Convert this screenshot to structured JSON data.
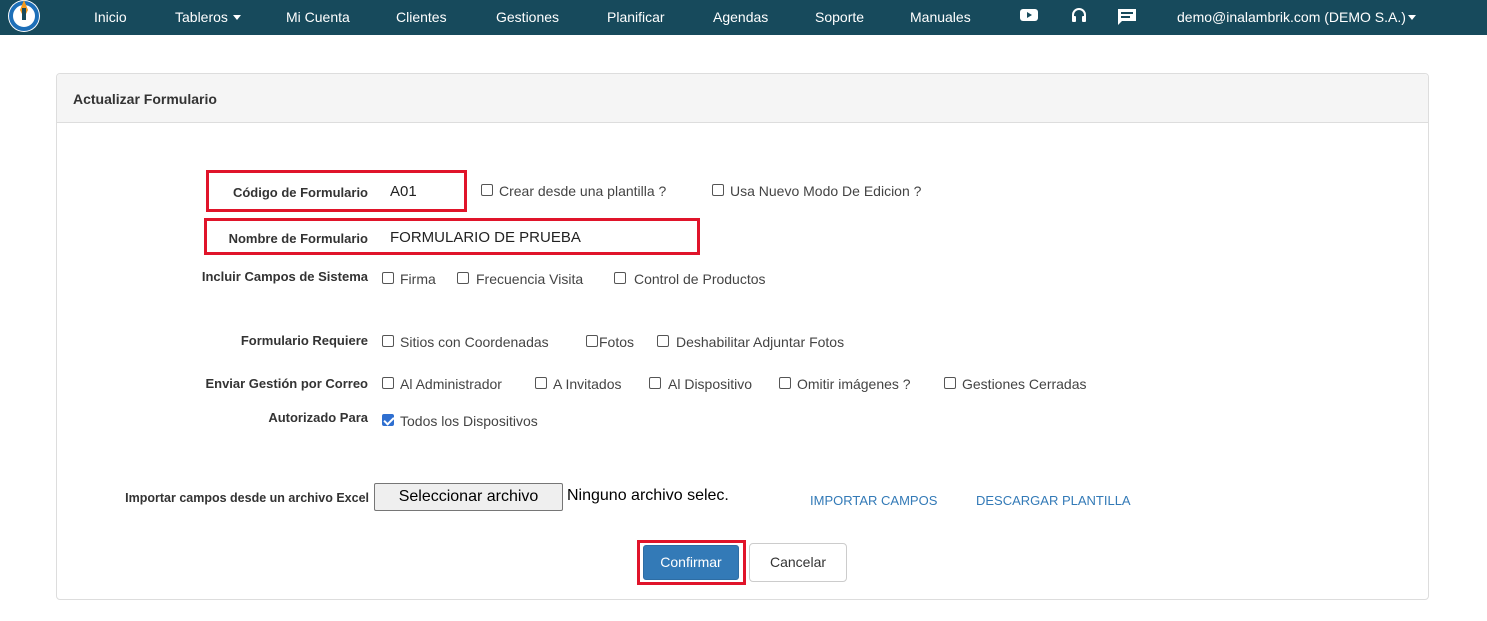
{
  "navbar": {
    "items": [
      "Inicio",
      "Tableros",
      "Mi Cuenta",
      "Clientes",
      "Gestiones",
      "Planificar",
      "Agendas",
      "Soporte",
      "Manuales"
    ],
    "icons": [
      "youtube-icon",
      "headset-icon",
      "chat-icon"
    ],
    "user": "demo@inalambrik.com (DEMO S.A.)",
    "color": "#174a5c"
  },
  "panel": {
    "title": "Actualizar Formulario"
  },
  "form": {
    "codigo_label": "Código de Formulario",
    "codigo_value": "A01",
    "crear_plantilla": "Crear desde una plantilla ?",
    "nuevo_modo": "Usa Nuevo Modo De Edicion ?",
    "nombre_label": "Nombre de Formulario",
    "nombre_value": "FORMULARIO DE PRUEBA",
    "campos_label": "Incluir Campos de Sistema",
    "campos_options": [
      "Firma",
      "Frecuencia Visita",
      "Control de Productos"
    ],
    "requiere_label": "Formulario Requiere",
    "requiere_options": [
      "Sitios con Coordenadas",
      "Fotos",
      "Deshabilitar Adjuntar Fotos"
    ],
    "correo_label": "Enviar Gestión por Correo",
    "correo_options": [
      "Al Administrador",
      "A Invitados",
      "Al Dispositivo",
      "Omitir imágenes ?",
      "Gestiones Cerradas"
    ],
    "autorizado_label": "Autorizado Para",
    "autorizado_option": "Todos los Dispositivos",
    "autorizado_checked": true,
    "importar_label": "Importar campos desde un archivo Excel",
    "file_button": "Seleccionar archivo",
    "file_name": "Ninguno archivo selec.",
    "importar_link": "IMPORTAR CAMPOS",
    "descargar_link": "DESCARGAR PLANTILLA",
    "confirm": "Confirmar",
    "cancel": "Cancelar"
  },
  "highlight_color": "#e0142a"
}
